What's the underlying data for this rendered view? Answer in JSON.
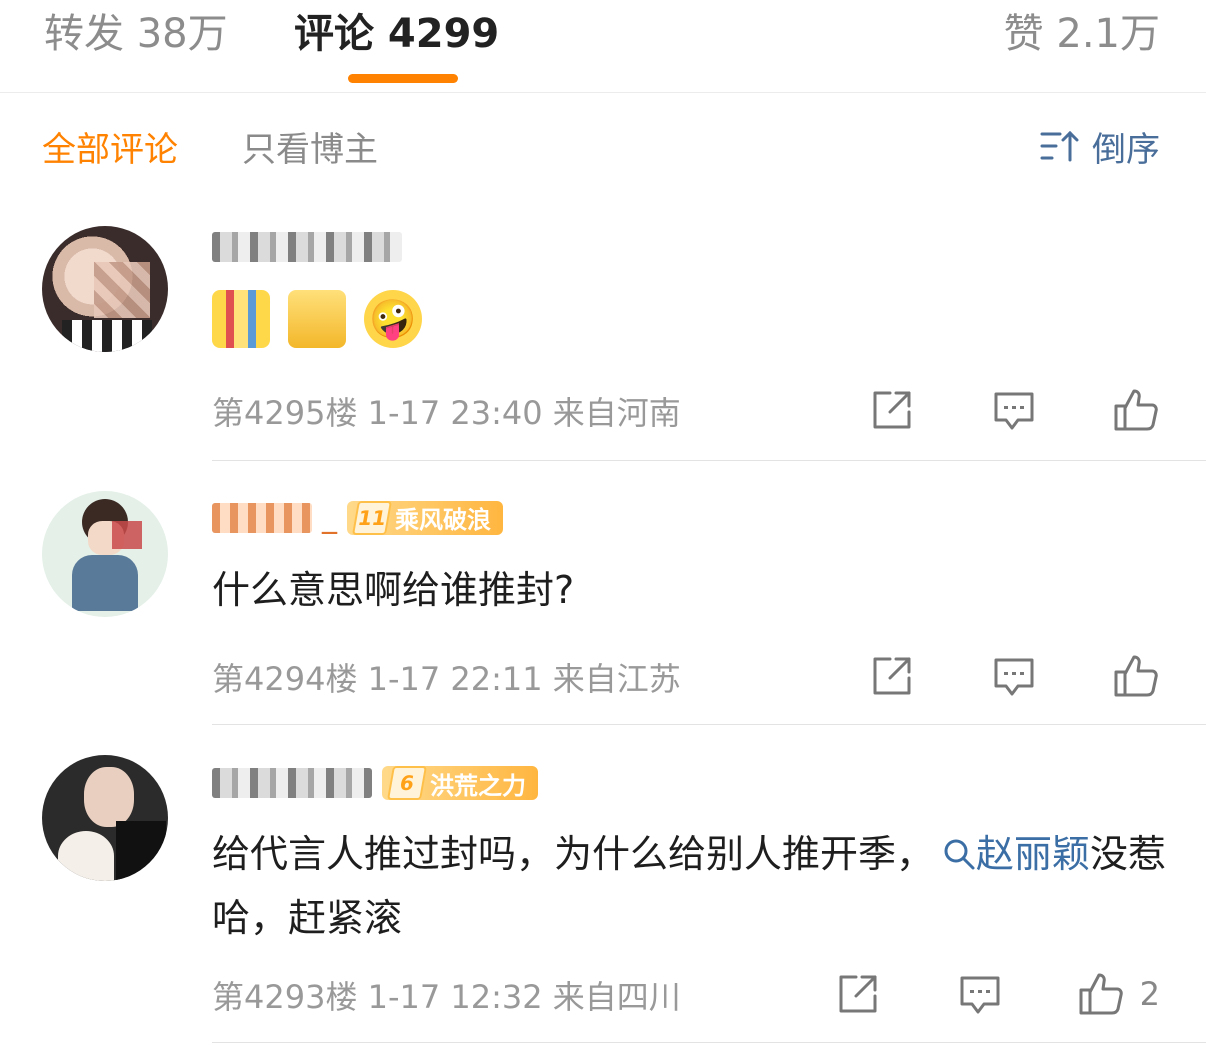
{
  "tabs": {
    "repost": "转发 38万",
    "comment": "评论 4299",
    "like": "赞 2.1万"
  },
  "filters": {
    "all": "全部评论",
    "poster_only": "只看博主",
    "sort": "倒序"
  },
  "colors": {
    "accent": "#ff8200",
    "link": "#3a6ea5",
    "muted": "#999999"
  },
  "comments": [
    {
      "username_hidden": true,
      "emoji_text": "🤪",
      "floor_time_location": "第4295楼 1-17 23:40 来自河南",
      "likes": ""
    },
    {
      "username_tail": "_",
      "badge_level": "11",
      "badge_label": "乘风破浪",
      "text": "什么意思啊给谁推封?",
      "floor_time_location": "第4294楼 1-17 22:11 来自江苏",
      "likes": ""
    },
    {
      "badge_level": "6",
      "badge_label": "洪荒之力",
      "text_before": "给代言人推过封吗，为什么给别人推开季，",
      "topic": "赵丽颖",
      "text_after": "没惹哈，赶紧滚",
      "floor_time_location": "第4293楼 1-17 12:32 来自四川",
      "likes": "2"
    }
  ]
}
